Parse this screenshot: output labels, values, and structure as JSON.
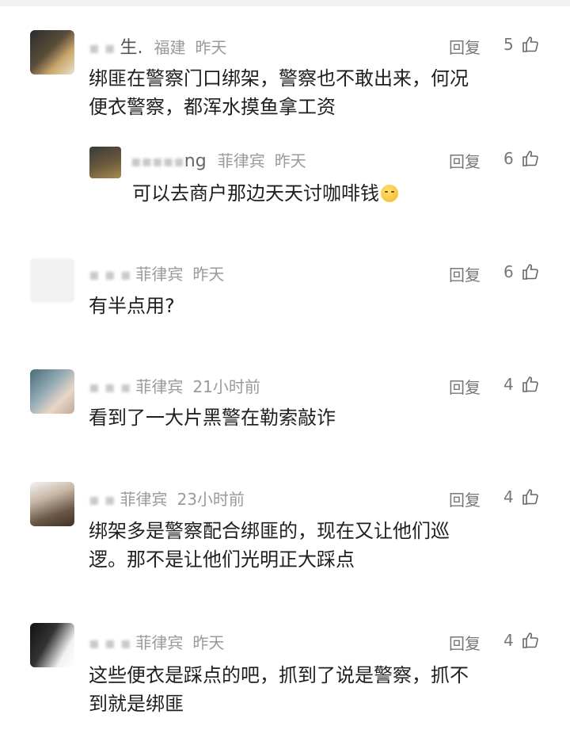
{
  "comments": [
    {
      "name_tail": "生.",
      "location": "福建",
      "time": "昨天",
      "reply_label": "回复",
      "likes": "5",
      "text_lines": [
        "绑匪在警察门口绑架，警察也不敢出来，何况",
        "便衣警察，都浑水摸鱼拿工资"
      ],
      "reply": {
        "name_tail": "ng",
        "location": "菲律宾",
        "time": "昨天",
        "reply_label": "回复",
        "likes": "6",
        "text": "可以去商户那边天天讨咖啡钱"
      }
    },
    {
      "name_tail": "",
      "location": "菲律宾",
      "time": "昨天",
      "reply_label": "回复",
      "likes": "6",
      "text_lines": [
        "有半点用?"
      ]
    },
    {
      "name_tail": "",
      "location": "菲律宾",
      "time": "21小时前",
      "reply_label": "回复",
      "likes": "4",
      "text_lines": [
        "看到了一大片黑警在勒索敲诈"
      ]
    },
    {
      "name_tail": "",
      "location": "菲律宾",
      "time": "23小时前",
      "reply_label": "回复",
      "likes": "4",
      "text_lines": [
        "绑架多是警察配合绑匪的，现在又让他们巡",
        "逻。那不是让他们光明正大踩点"
      ]
    },
    {
      "name_tail": "",
      "location": "菲律宾",
      "time": "昨天",
      "reply_label": "回复",
      "likes": "4",
      "text_lines": [
        "这些便衣是踩点的吧，抓到了说是警察，抓不",
        "到就是绑匪"
      ]
    }
  ],
  "colors": {
    "meta": "#9a9a9a",
    "text": "#1f1f1f",
    "action": "#777777"
  },
  "icons": {
    "like": "thumbs-up-outline-icon"
  }
}
